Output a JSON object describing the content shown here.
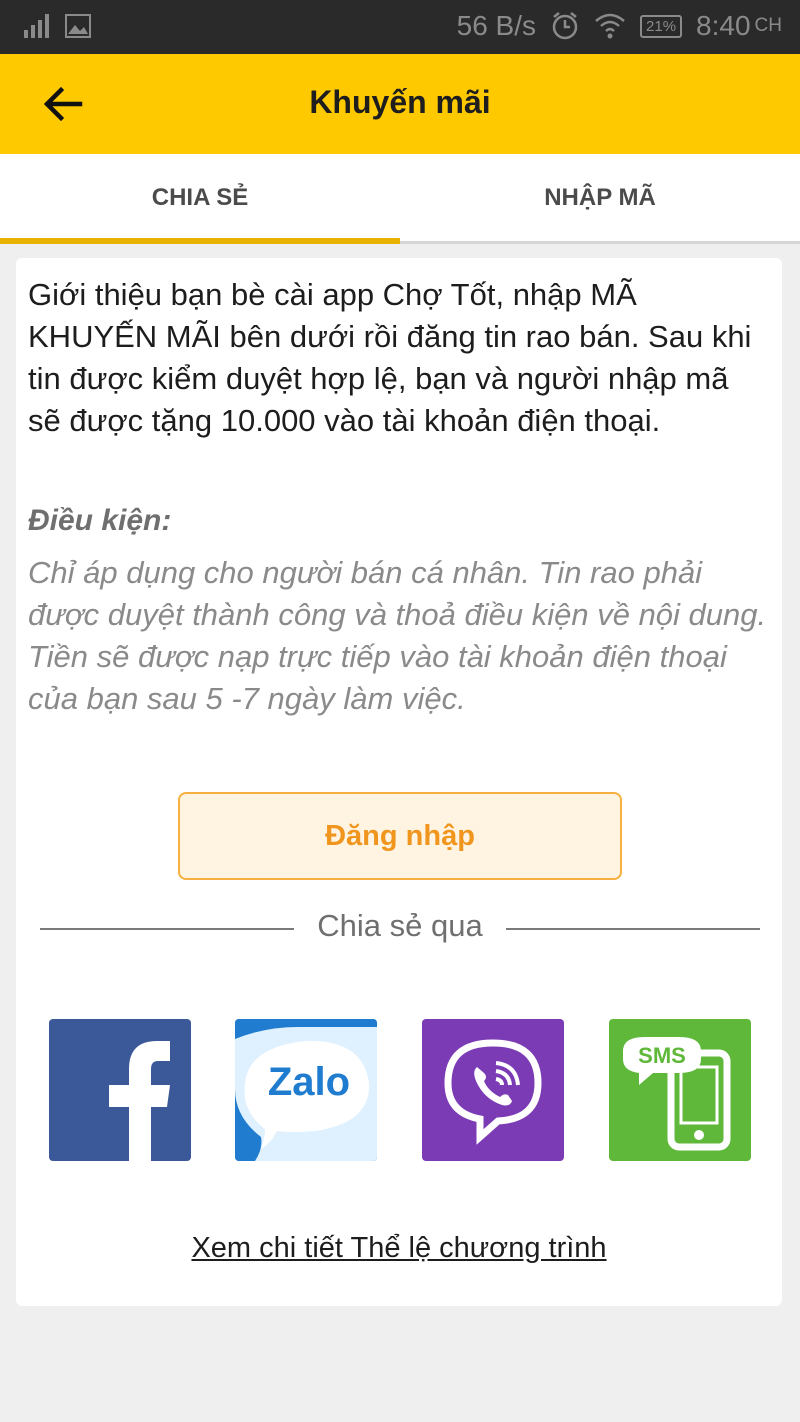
{
  "status_bar": {
    "net_speed": "56 B/s",
    "battery": "21%",
    "time": "8:40",
    "ampm": "CH"
  },
  "app_bar": {
    "title": "Khuyến mãi"
  },
  "tabs": [
    {
      "label": "CHIA SẺ",
      "active": true
    },
    {
      "label": "NHẬP MÃ",
      "active": false
    }
  ],
  "content": {
    "intro": "Giới thiệu bạn bè cài app Chợ Tốt, nhập MÃ KHUYẾN MÃI bên dưới rồi đăng tin rao bán. Sau khi tin được kiểm duyệt hợp lệ, bạn và người nhập mã sẽ được tặng 10.000 vào tài khoản điện thoại.",
    "condition_title": "Điều kiện:",
    "condition_text": "Chỉ áp dụng cho người bán cá nhân. Tin rao phải được duyệt thành công và thoả điều kiện về nội dung. Tiền sẽ được nạp trực tiếp vào tài khoản điện thoại của bạn sau 5 -7 ngày làm việc.",
    "login_button": "Đăng nhập",
    "share_via": "Chia sẻ qua",
    "share_options": [
      {
        "name": "Facebook",
        "icon": "facebook-icon",
        "color": "#3b5998"
      },
      {
        "name": "Zalo",
        "icon": "zalo-icon",
        "label": "Zalo",
        "color": "#1f7ccf"
      },
      {
        "name": "Viber",
        "icon": "viber-icon",
        "color": "#7b3bb5"
      },
      {
        "name": "SMS",
        "icon": "sms-icon",
        "label": "SMS",
        "color": "#5fb83a"
      }
    ],
    "rules_link": "Xem chi tiết Thể lệ chương trình"
  },
  "colors": {
    "app_bar": "#ffc900",
    "tab_indicator": "#e9b200",
    "login_text": "#f0961e"
  }
}
